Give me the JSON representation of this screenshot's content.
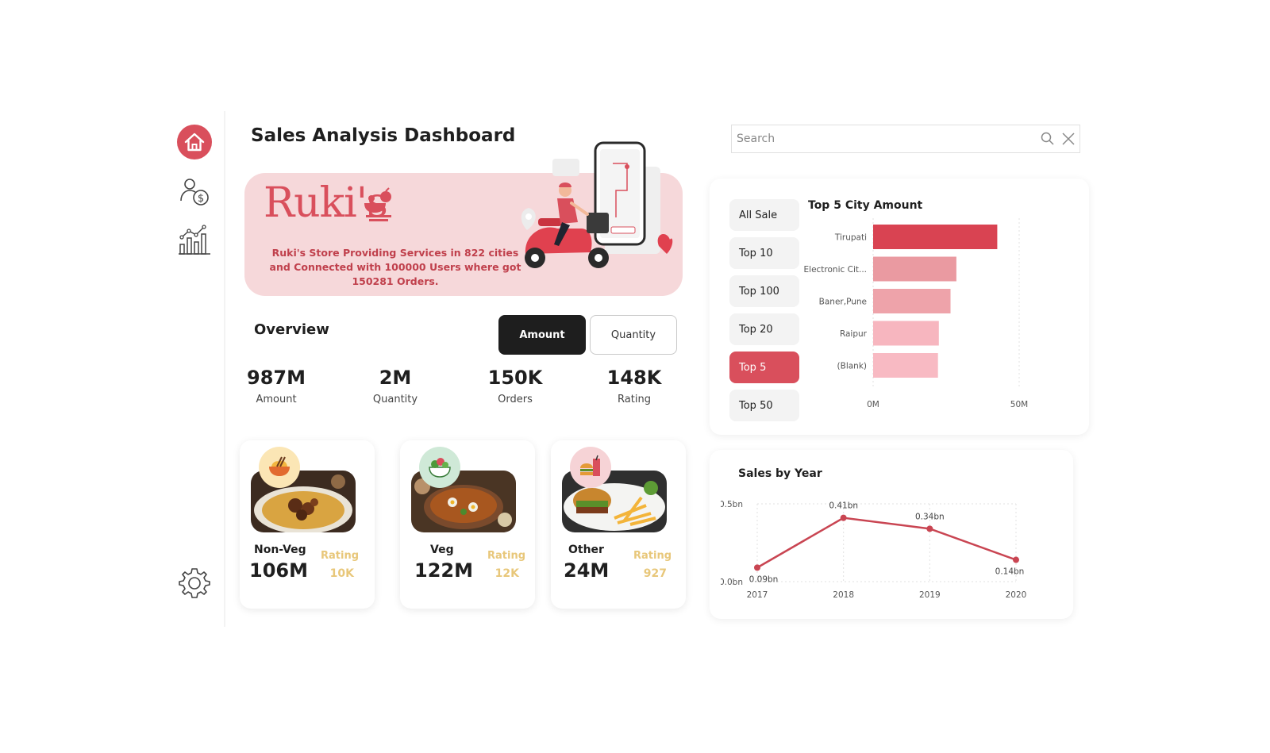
{
  "page": {
    "title": "Sales Analysis Dashboard"
  },
  "nav": {
    "items": [
      {
        "name": "home-icon"
      },
      {
        "name": "customer-money-icon"
      },
      {
        "name": "analytics-chart-icon"
      },
      {
        "name": "settings-gear-icon"
      }
    ]
  },
  "banner": {
    "brand": "Ruki's",
    "text": "Ruki's Store Providing Services in 822 cities and Connected with 100000 Users where got 150281 Orders."
  },
  "overview": {
    "heading": "Overview",
    "toggle_amount": "Amount",
    "toggle_quantity": "Quantity",
    "kpis": [
      {
        "value": "987M",
        "label": "Amount"
      },
      {
        "value": "2M",
        "label": "Quantity"
      },
      {
        "value": "150K",
        "label": "Orders"
      },
      {
        "value": "148K",
        "label": "Rating"
      }
    ]
  },
  "categories": [
    {
      "name": "Non-Veg",
      "value": "106M",
      "rating_label": "Rating",
      "rating": "10K"
    },
    {
      "name": "Veg",
      "value": "122M",
      "rating_label": "Rating",
      "rating": "12K"
    },
    {
      "name": "Other",
      "value": "24M",
      "rating_label": "Rating",
      "rating": "927"
    }
  ],
  "search": {
    "placeholder": "Search"
  },
  "filters": {
    "items": [
      "All Sale",
      "Top 10",
      "Top 100",
      "Top 20",
      "Top 5",
      "Top 50"
    ],
    "active": "Top 5"
  },
  "colors": {
    "accent": "#d94f5c",
    "rating": "#e8c77a",
    "banner_bg": "#f6d8da"
  },
  "chart_data": [
    {
      "type": "bar",
      "orientation": "horizontal",
      "title": "Top 5 City Amount",
      "categories": [
        "Tirupati",
        "Electronic Cit...",
        "Baner,Pune",
        "Raipur",
        "(Blank)"
      ],
      "values": [
        42.5,
        28.5,
        26.5,
        22.5,
        22.2
      ],
      "xticks": [
        "0M",
        "50M"
      ],
      "xlim": [
        0,
        50
      ],
      "grid": true,
      "bar_colors": [
        "#d94352",
        "#ea9aa1",
        "#eea3aa",
        "#f7b6bf",
        "#f8bac3"
      ]
    },
    {
      "type": "line",
      "title": "Sales by Year",
      "x": [
        "2017",
        "2018",
        "2019",
        "2020"
      ],
      "values": [
        0.09,
        0.41,
        0.34,
        0.14
      ],
      "data_labels": [
        "0.09bn",
        "0.41bn",
        "0.34bn",
        "0.14bn"
      ],
      "yticks": [
        "0.0bn",
        "0.5bn"
      ],
      "ylim": [
        0,
        0.5
      ],
      "grid": true,
      "line_color": "#c94552"
    }
  ]
}
